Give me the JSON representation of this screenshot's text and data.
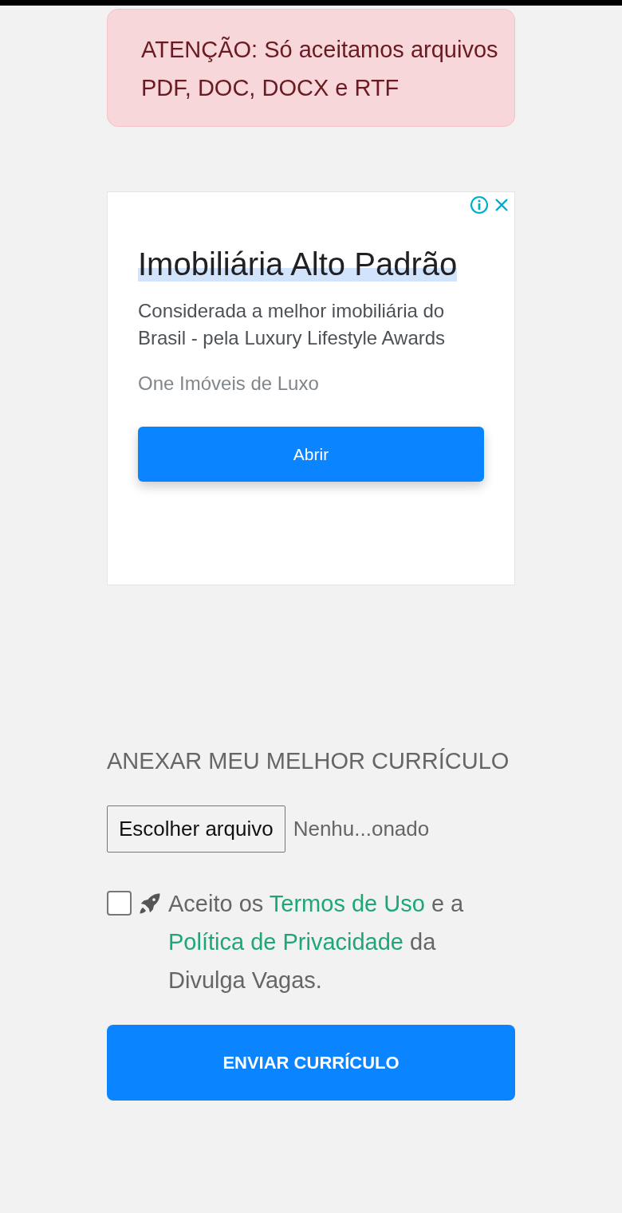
{
  "alert": {
    "text": "ATENÇÃO: Só aceitamos arquivos PDF, DOC, DOCX e RTF"
  },
  "ad": {
    "title": "Imobiliária Alto Padrão",
    "description": "Considerada a melhor imobiliária do Brasil - pela Luxury Lifestyle Awards",
    "advertiser": "One Imóveis de Luxo",
    "button": "Abrir"
  },
  "upload": {
    "heading": "ANEXAR MEU MELHOR CURRÍCULO",
    "file_button": "Escolher arquivo",
    "file_status": "Nenhu...onado"
  },
  "consent": {
    "checked": false,
    "parts": [
      {
        "kind": "text",
        "text": "Aceito os "
      },
      {
        "kind": "link",
        "text": "Termos de Uso"
      },
      {
        "kind": "text",
        "text": " e a "
      },
      {
        "kind": "link",
        "text": "Política de Privacidade"
      },
      {
        "kind": "text",
        "text": " da Divulga Vagas."
      }
    ]
  },
  "submit": {
    "label": "ENVIAR CURRÍCULO"
  }
}
